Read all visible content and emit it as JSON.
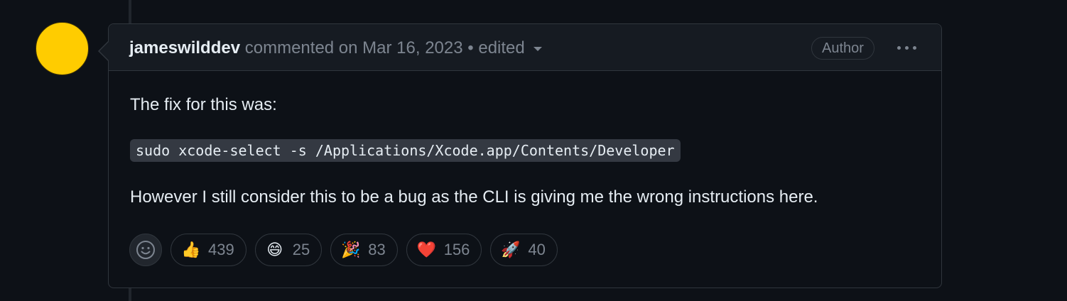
{
  "comment": {
    "author": "jameswilddev",
    "meta_text": "commented on Mar 16, 2023",
    "separator": "•",
    "edited_label": "edited",
    "badge": "Author",
    "body": {
      "paragraph1": "The fix for this was:",
      "code": "sudo xcode-select -s /Applications/Xcode.app/Contents/Developer",
      "paragraph2": "However I still consider this to be a bug as the CLI is giving me the wrong instructions here."
    },
    "avatar_color": "#ffcc00"
  },
  "reactions": [
    {
      "icon": "thumbs-up-icon",
      "emoji": "👍",
      "count": "439"
    },
    {
      "icon": "laugh-icon",
      "emoji": "😄",
      "count": "25"
    },
    {
      "icon": "party-popper-icon",
      "emoji": "🎉",
      "count": "83"
    },
    {
      "icon": "heart-icon",
      "emoji": "❤️",
      "count": "156"
    },
    {
      "icon": "rocket-icon",
      "emoji": "🚀",
      "count": "40"
    }
  ]
}
